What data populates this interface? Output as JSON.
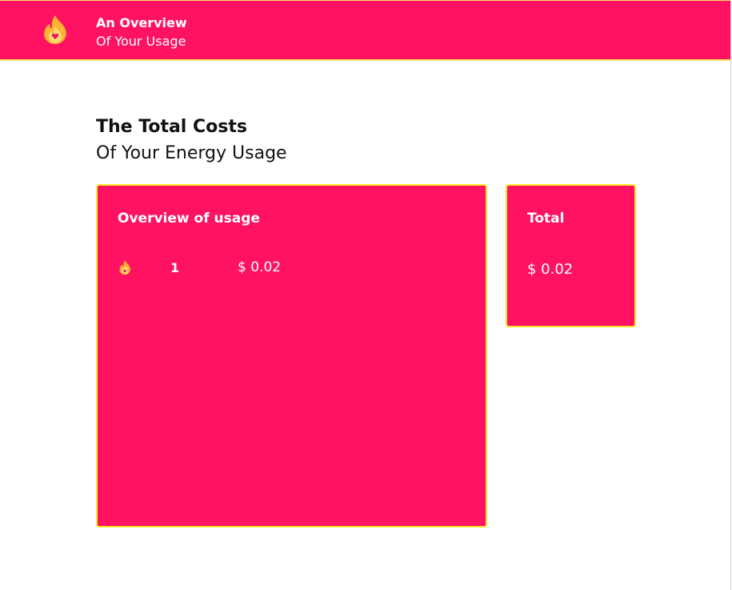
{
  "header": {
    "title": "An Overview",
    "subtitle": "Of Your Usage",
    "logo_icon": "flame-heart-icon"
  },
  "section": {
    "title": "The Total Costs",
    "subtitle": "Of Your Energy Usage"
  },
  "overview_card": {
    "heading": "Overview of usage",
    "rows": [
      {
        "icon": "flame-icon",
        "count": "1",
        "cost": "$ 0.02"
      }
    ]
  },
  "total_card": {
    "heading": "Total",
    "value": "$ 0.02"
  },
  "colors": {
    "brand": "#ff1262",
    "accent_border": "#ffe82a",
    "flame_outer": "#ffbb33",
    "flame_inner": "#ffd866"
  }
}
